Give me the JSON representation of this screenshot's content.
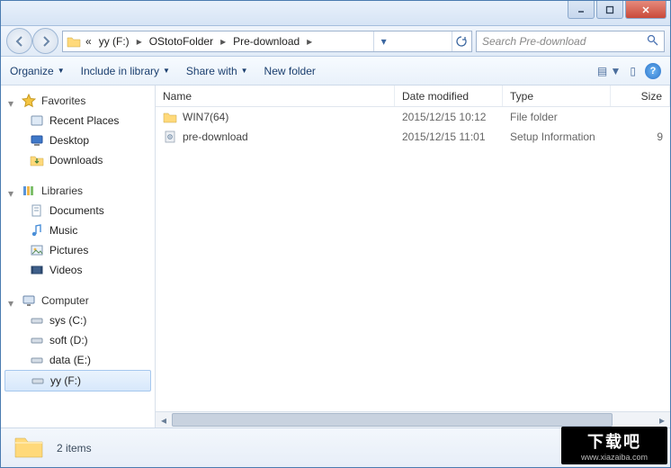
{
  "titlebar": {
    "min_icon": "minimize-icon",
    "max_icon": "maximize-icon",
    "close_icon": "close-icon"
  },
  "nav": {
    "overflow_label": "«",
    "segments": [
      "yy (F:)",
      "OStotoFolder",
      "Pre-download"
    ]
  },
  "search": {
    "placeholder": "Search Pre-download"
  },
  "toolbar": {
    "organize": "Organize",
    "include": "Include in library",
    "share": "Share with",
    "newfolder": "New folder"
  },
  "columns": {
    "name": "Name",
    "date": "Date modified",
    "type": "Type",
    "size": "Size"
  },
  "files": [
    {
      "icon": "folder",
      "name": "WIN7(64)",
      "date": "2015/12/15 10:12",
      "type": "File folder",
      "size": ""
    },
    {
      "icon": "inf",
      "name": "pre-download",
      "date": "2015/12/15 11:01",
      "type": "Setup Information",
      "size": "9"
    }
  ],
  "sidebar": {
    "favorites": {
      "label": "Favorites",
      "items": [
        "Recent Places",
        "Desktop",
        "Downloads"
      ]
    },
    "libraries": {
      "label": "Libraries",
      "items": [
        "Documents",
        "Music",
        "Pictures",
        "Videos"
      ]
    },
    "computer": {
      "label": "Computer",
      "items": [
        "sys (C:)",
        "soft (D:)",
        "data (E:)",
        "yy (F:)"
      ],
      "selected": 3
    }
  },
  "status": {
    "text": "2 items"
  },
  "watermark": {
    "line1": "下载吧",
    "line2": "www.xiazaiba.com"
  }
}
